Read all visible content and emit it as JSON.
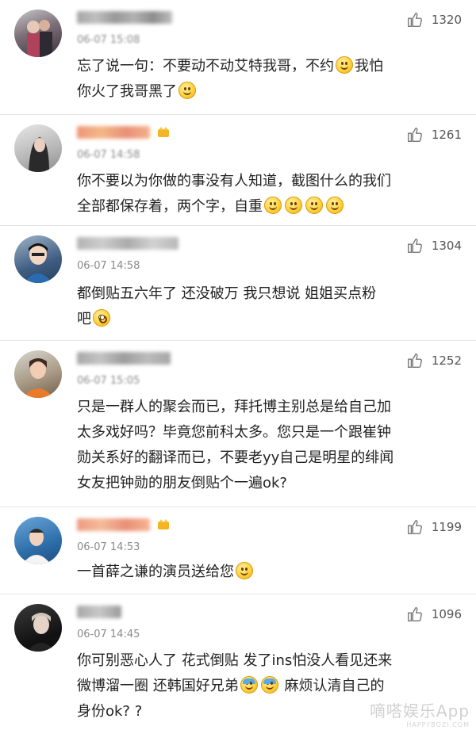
{
  "comments": [
    {
      "time": "06-07 15:08",
      "likes": "1320",
      "lines": [
        "忘了说一句：不要动不动艾特我哥，不约",
        "你火了我哥黑了"
      ]
    },
    {
      "time": "06-07 14:58",
      "likes": "1261",
      "lines": [
        "你不要以为你做的事没有人知道，截图什么的我们",
        "全部都保存着，两个字，自重"
      ]
    },
    {
      "time": "06-07 14:58",
      "likes": "1304",
      "lines": [
        "都倒贴五六年了  还没破万  我只想说  姐姐买点粉",
        "吧"
      ]
    },
    {
      "time": "06-07 15:05",
      "likes": "1252",
      "lines": [
        "只是一群人的聚会而已，拜托博主别总是给自己加",
        "太多戏好吗？毕竟您前科太多。您只是一个跟崔钟",
        "勋关系好的翻译而已，不要老yy自己是明星的绯闻",
        "女友把钟勋的朋友倒贴个一遍ok?"
      ]
    },
    {
      "time": "06-07 14:53",
      "likes": "1199",
      "lines": [
        "一首薛之谦的演员送给您"
      ]
    },
    {
      "time": "06-07 14:45",
      "likes": "1096",
      "lines": [
        "你可别恶心人了  花式倒贴  发了ins怕没人看见还来",
        "微博溜一圈  还韩国好兄弟",
        "麻烦认清自己的",
        "身份ok?  ?"
      ]
    }
  ],
  "watermark": {
    "main": "嘀嗒娱乐App",
    "sub": "HAPPYBOZI.COM"
  },
  "colors": {
    "divider": "#e6e6e6",
    "text": "#222222",
    "meta": "#8a8a8a",
    "emoji": "#ffd23c"
  }
}
